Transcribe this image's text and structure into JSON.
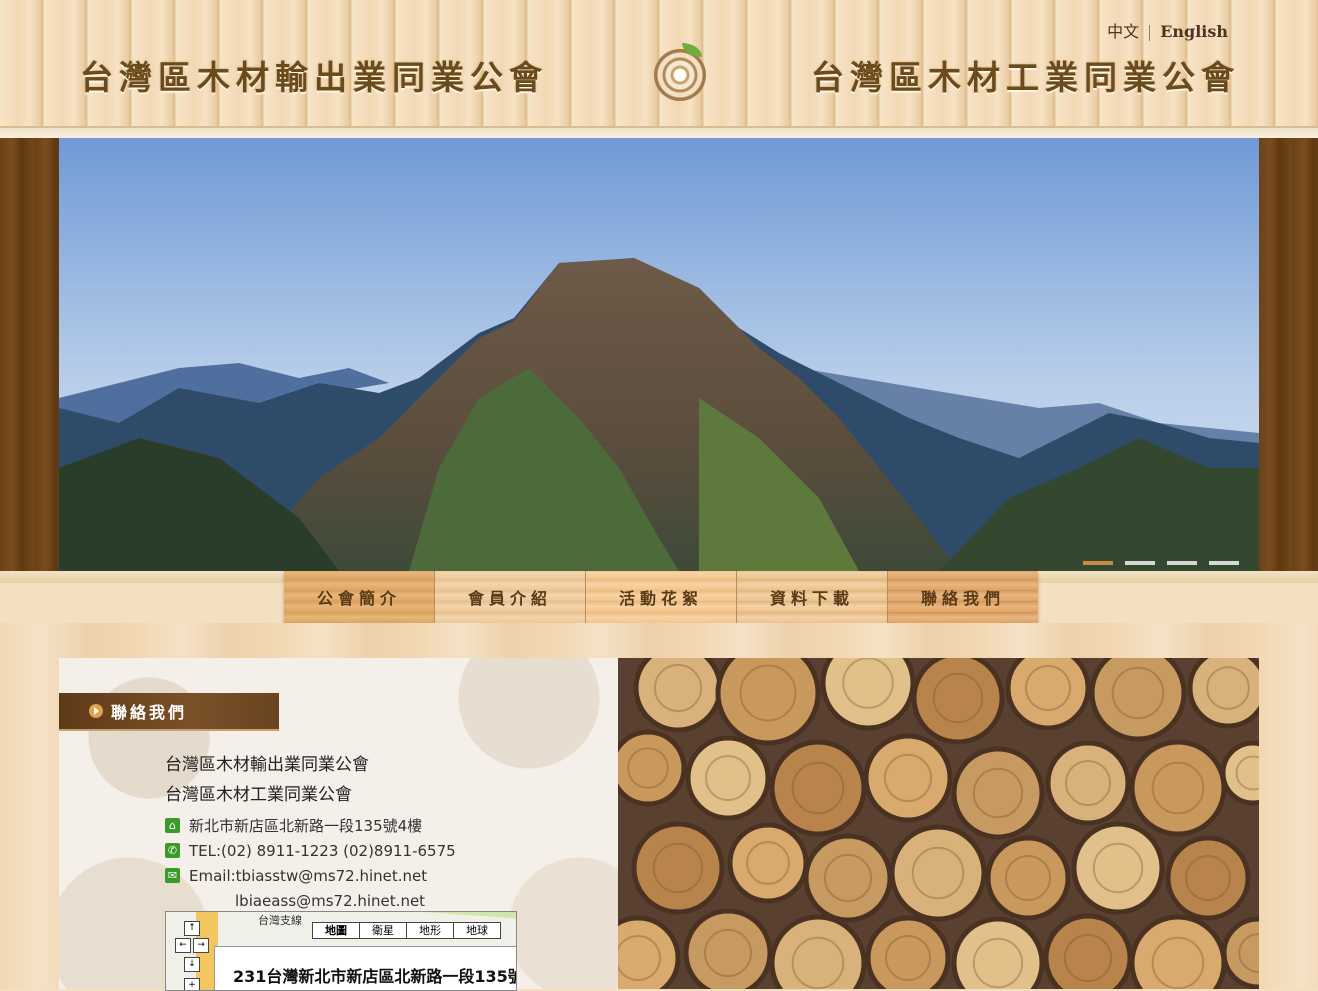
{
  "header": {
    "lang_zh": "中文",
    "lang_en": "English",
    "title_left": "台灣區木材輸出業同業公會",
    "title_right": "台灣區木材工業同業公會",
    "logo_icon": "wood-ring-leaf-logo"
  },
  "banner": {
    "slide_count": 4,
    "active_slide": 1
  },
  "nav": {
    "items": [
      "公會簡介",
      "會員介紹",
      "活動花絮",
      "資料下載",
      "聯絡我們"
    ]
  },
  "contact": {
    "section_title": "聯絡我們",
    "org1": "台灣區木材輸出業同業公會",
    "org2": "台灣區木材工業同業公會",
    "address": "新北市新店區北新路一段135號4樓",
    "tel": "TEL:(02) 8911-1223 (02)8911-6575",
    "email1": "Email:tbiasstw@ms72.hinet.net",
    "email2": "lbiaeass@ms72.hinet.net",
    "icons": {
      "address": "home-icon",
      "tel": "phone-icon",
      "email": "mail-icon"
    },
    "accent_color": "#3a9b2a"
  },
  "map": {
    "types": [
      "地圖",
      "衛星",
      "地形",
      "地球"
    ],
    "active_type": "地圖",
    "road_label": "台灣支線",
    "bubble_address": "231台灣新北市新店區北新路一段135號"
  }
}
